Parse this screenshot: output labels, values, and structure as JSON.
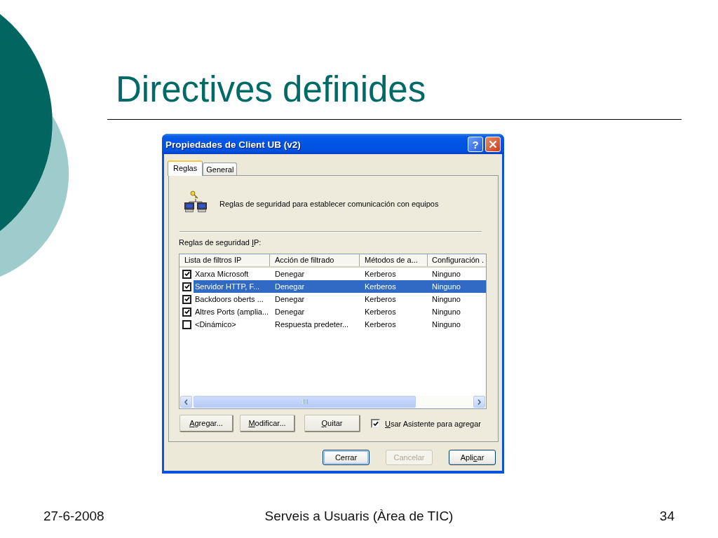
{
  "slide": {
    "title": "Directives definides"
  },
  "dialog": {
    "title": "Propiedades de Client UB (v2)",
    "title_buttons": [
      {
        "kind": "help",
        "glyph": "?"
      },
      {
        "kind": "close"
      }
    ],
    "tabs": [
      {
        "label": "Reglas",
        "selected": true
      },
      {
        "label": "General",
        "selected": false
      }
    ],
    "description": "Reglas de seguridad para establecer comunicación con equipos",
    "rules_label": {
      "text_before_key": "Reglas de seguridad ",
      "access_key": "I",
      "text_after_key": "P:"
    },
    "table": {
      "columns": [
        "Lista de filtros IP",
        "Acción de filtrado",
        "Métodos de a...",
        "Configuración ."
      ],
      "rows": [
        {
          "checked": true,
          "selected": false,
          "cells": [
            "Xarxa Microsoft",
            "Denegar",
            "Kerberos",
            "Ninguno"
          ]
        },
        {
          "checked": true,
          "selected": true,
          "cells": [
            "Servidor HTTP, F...",
            "Denegar",
            "Kerberos",
            "Ninguno"
          ]
        },
        {
          "checked": true,
          "selected": false,
          "cells": [
            "Backdoors oberts ...",
            "Denegar",
            "Kerberos",
            "Ninguno"
          ]
        },
        {
          "checked": true,
          "selected": false,
          "cells": [
            "Altres Ports (amplia...",
            "Denegar",
            "Kerberos",
            "Ninguno"
          ]
        },
        {
          "checked": false,
          "selected": false,
          "cells": [
            "<Dinámico>",
            "Respuesta predeter...",
            "Kerberos",
            "Ninguno"
          ]
        }
      ]
    },
    "list_buttons": [
      {
        "access_key": "A",
        "text_after_key": "gregar..."
      },
      {
        "access_key": "M",
        "text_after_key": "odificar..."
      },
      {
        "access_key": "Q",
        "text_after_key": "uitar"
      }
    ],
    "wizard_checkbox": {
      "access_key": "U",
      "text_after_key": "sar Asistente para agregar",
      "checked": true
    },
    "buttons": [
      {
        "label": "Cerrar",
        "default": true,
        "disabled": false
      },
      {
        "label": "Cancelar",
        "default": false,
        "disabled": true
      },
      {
        "text_before_key": "Apli",
        "access_key": "c",
        "text_after_key": "ar",
        "default": false,
        "disabled": false
      }
    ]
  },
  "footer": {
    "date": "27-6-2008",
    "text": "Serveis a Usuaris (Àrea de TIC)",
    "page": "34"
  }
}
